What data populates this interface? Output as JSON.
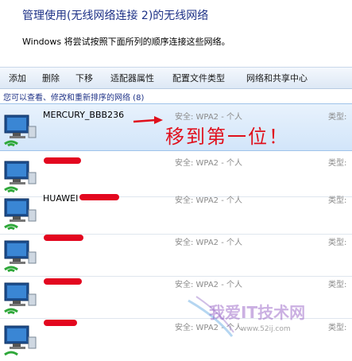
{
  "window": {
    "title": "管理使用(无线网络连接 2)的无线网络",
    "description": "Windows 将尝试按照下面所列的顺序连接这些网络。"
  },
  "toolbar": {
    "items": [
      "添加",
      "删除",
      "下移",
      "适配器属性",
      "配置文件类型",
      "网络和共享中心"
    ]
  },
  "list": {
    "header": "您可以查看、修改和重新排序的网络 (8)",
    "networks": [
      {
        "name": "MERCURY_BBB236",
        "security": "安全: WPA2 - 个人",
        "type": "类型:",
        "icon": "wireless-network-icon"
      },
      {
        "name": "",
        "security": "安全: WPA2 - 个人",
        "type": "类型:",
        "icon": "wireless-network-icon"
      },
      {
        "name": "HUAWEI",
        "security": "安全: WPA2 - 个人",
        "type": "类型:",
        "icon": "wireless-network-icon"
      },
      {
        "name": "",
        "security": "安全: WPA2 - 个人",
        "type": "类型:",
        "icon": "wireless-network-icon"
      },
      {
        "name": "",
        "security": "安全: WPA2 - 个人",
        "type": "类型:",
        "icon": "wireless-network-icon"
      },
      {
        "name": "",
        "security": "安全: WPA2 - 个人",
        "type": "类型:",
        "icon": "wireless-network-icon"
      }
    ]
  },
  "annotation": {
    "text": "移到第一位！",
    "color": "#e0101c"
  },
  "watermark": {
    "text": "我爱IT技术网",
    "sub": "www.52ij.com"
  },
  "colors": {
    "title": "#1e3287",
    "selected_row": "#d2e5fa",
    "redaction": "#e3071f"
  }
}
